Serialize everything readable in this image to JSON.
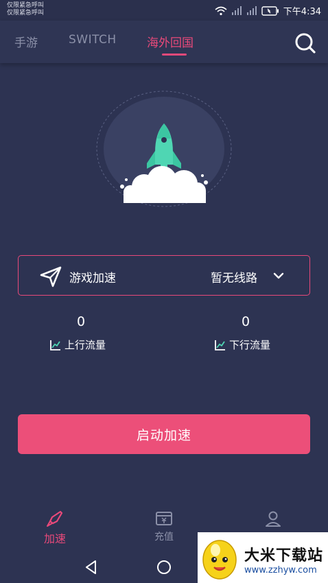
{
  "status_bar": {
    "emergency_line1": "仅限紧急呼叫",
    "emergency_line2": "仅限紧急呼叫",
    "time": "下午4:34"
  },
  "tabs": [
    {
      "label": "手游",
      "active": false
    },
    {
      "label": "SWITCH",
      "active": false
    },
    {
      "label": "海外回国",
      "active": true
    }
  ],
  "route": {
    "label": "游戏加速",
    "value": "暂无线路"
  },
  "traffic": {
    "upload": {
      "value": "0",
      "label": "上行流量"
    },
    "download": {
      "value": "0",
      "label": "下行流量"
    }
  },
  "start_button": "启动加速",
  "bottom_nav": [
    {
      "label": "加速",
      "icon": "rocket-icon",
      "active": true
    },
    {
      "label": "充值",
      "icon": "wallet-icon",
      "active": false
    },
    {
      "label": "",
      "icon": "user-icon",
      "active": false
    }
  ],
  "watermark": {
    "title": "大米下载站",
    "url": "www.zzhyw.com"
  },
  "colors": {
    "background": "#2d3352",
    "accent": "#e9497a",
    "button": "#ec4f79",
    "rocket": "#4fd6b3",
    "muted": "#8b90a8"
  }
}
